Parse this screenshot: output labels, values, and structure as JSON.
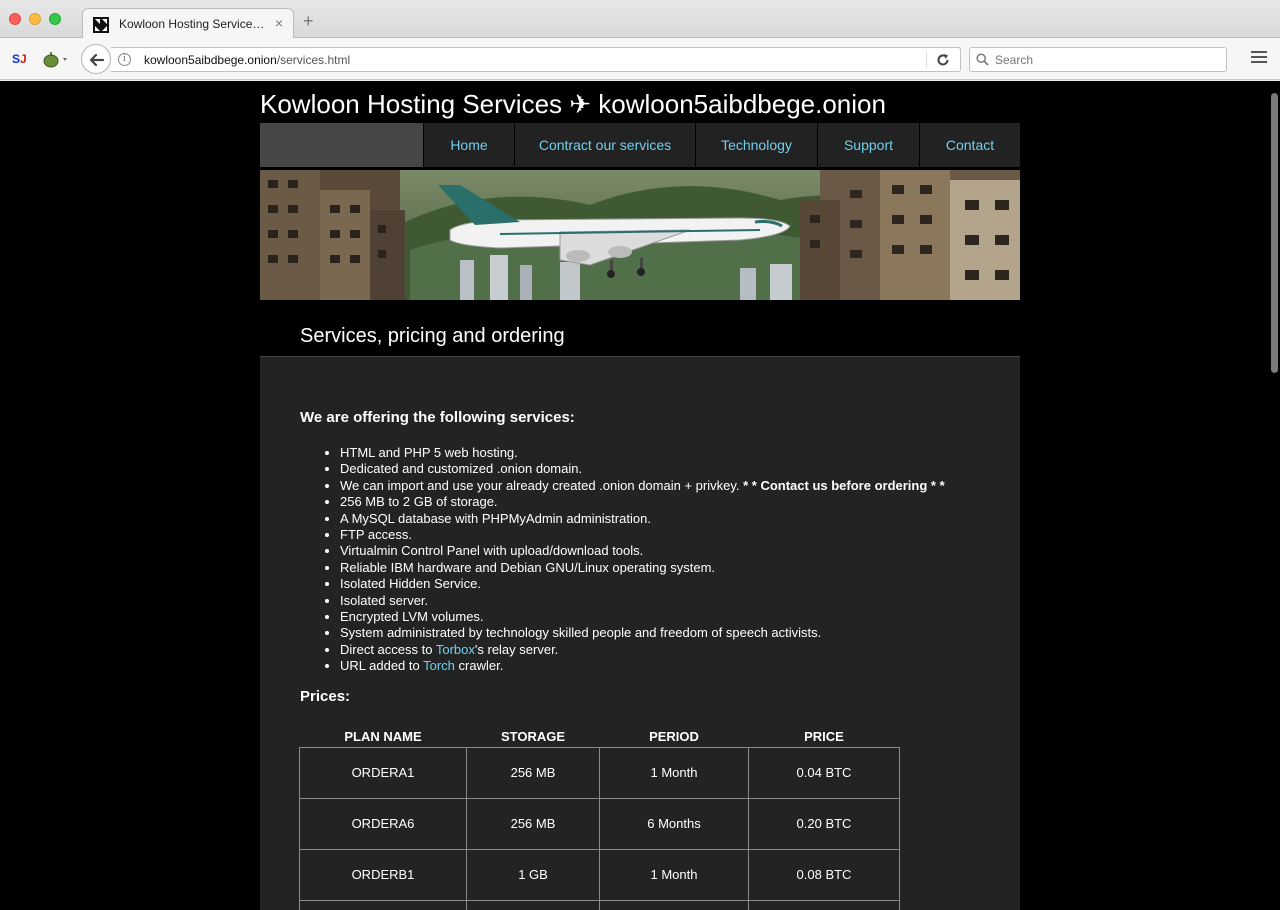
{
  "browser": {
    "tab_title": "Kowloon Hosting Services ✈ kowloon5aibdbege.onion",
    "url_host": "kowloon5aibdbege.onion",
    "url_path": "/services.html",
    "search_placeholder": "Search",
    "ext1_a": "S",
    "ext1_b": "J"
  },
  "site": {
    "title": "Kowloon Hosting Services ✈ kowloon5aibdbege.onion",
    "nav": [
      "Home",
      "Contract our services",
      "Technology",
      "Support",
      "Contact"
    ],
    "section_title": "Services, pricing and ordering",
    "link_color": "#6fd0f0"
  },
  "services": {
    "heading": "We are offering the following services:",
    "items": [
      "HTML and PHP 5 web hosting.",
      "Dedicated and customized .onion domain.",
      "We can import and use your already created .onion domain + privkey.",
      "256 MB to 2 GB of storage.",
      "A MySQL database with PHPMyAdmin administration.",
      "FTP access.",
      "Virtualmin Control Panel with upload/download tools.",
      "Reliable IBM hardware and Debian GNU/Linux operating system.",
      "Isolated Hidden Service.",
      "Isolated server.",
      "Encrypted LVM volumes.",
      "System administrated by technology skilled people and freedom of speech activists."
    ],
    "import_note": "* * Contact us before ordering * *",
    "torbox_pre": "Direct access to ",
    "torbox_link": "Torbox",
    "torbox_post": "'s relay server.",
    "torch_pre": "URL added to ",
    "torch_link": "Torch",
    "torch_post": " crawler."
  },
  "prices": {
    "heading": "Prices:",
    "columns": [
      "PLAN NAME",
      "STORAGE",
      "PERIOD",
      "PRICE"
    ],
    "rows": [
      [
        "ORDERA1",
        "256 MB",
        "1 Month",
        "0.04 BTC"
      ],
      [
        "ORDERA6",
        "256 MB",
        "6 Months",
        "0.20 BTC"
      ],
      [
        "ORDERB1",
        "1 GB",
        "1 Month",
        "0.08 BTC"
      ]
    ]
  }
}
